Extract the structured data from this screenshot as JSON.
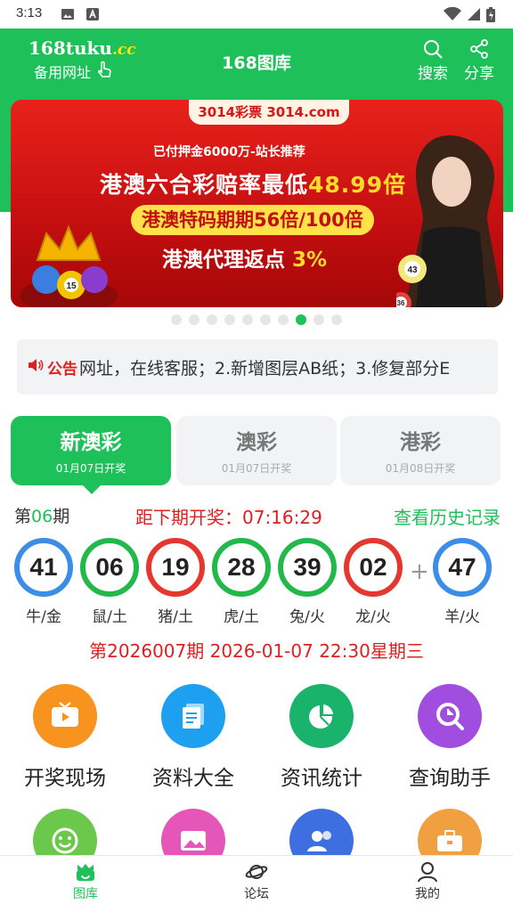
{
  "status_bar": {
    "time": "3:13"
  },
  "header": {
    "logo_main": "168tuku",
    "logo_suffix": ".cc",
    "backup_label": "备用网址",
    "title": "168图库",
    "search_label": "搜索",
    "share_label": "分享"
  },
  "banner": {
    "brand": "3014彩票 3014.com",
    "subline": "已付押金6000万-站长推荐",
    "line1": "港澳六合彩赔率最低",
    "line1_highlight": "48.99倍",
    "line2": "港澳特码期期56倍/100倍",
    "line3": "港澳代理返点",
    "line3_highlight": "3%",
    "ball_a": "15",
    "ball_b": "43",
    "ball_c": "36"
  },
  "carousel": {
    "count": 10,
    "active_index": 7
  },
  "notice": {
    "label": "公告",
    "text": "网址，在线客服；2.新增图层AB纸；3.修复部分E"
  },
  "tabs": [
    {
      "name": "新澳彩",
      "date": "01月07日开奖",
      "active": true
    },
    {
      "name": "澳彩",
      "date": "01月07日开奖",
      "active": false
    },
    {
      "name": "港彩",
      "date": "01月08日开奖",
      "active": false
    }
  ],
  "period": {
    "prefix": "第",
    "number": "06",
    "suffix": "期",
    "countdown": "距下期开奖：07:16:29",
    "history_link": "查看历史记录"
  },
  "balls": [
    {
      "num": "41",
      "zodiac": "牛/金",
      "color": "blue"
    },
    {
      "num": "06",
      "zodiac": "鼠/土",
      "color": "green"
    },
    {
      "num": "19",
      "zodiac": "猪/土",
      "color": "red"
    },
    {
      "num": "28",
      "zodiac": "虎/土",
      "color": "green"
    },
    {
      "num": "39",
      "zodiac": "兔/火",
      "color": "green"
    },
    {
      "num": "02",
      "zodiac": "龙/火",
      "color": "red"
    },
    {
      "num": "47",
      "zodiac": "羊/火",
      "color": "blue"
    }
  ],
  "plus_sign": "+",
  "next_draw": "第2026007期 2026-01-07 22:30星期三",
  "menu": [
    {
      "label": "开奖现场",
      "icon": "tv-icon",
      "color": "#f7931e"
    },
    {
      "label": "资料大全",
      "icon": "document-icon",
      "color": "#1ea0f0"
    },
    {
      "label": "资讯统计",
      "icon": "pie-chart-icon",
      "color": "#19b36b"
    },
    {
      "label": "查询助手",
      "icon": "search-chart-icon",
      "color": "#a14de0"
    }
  ],
  "menu_row2": [
    {
      "icon": "smile-icon",
      "color": "#6cc84a"
    },
    {
      "icon": "gallery-icon",
      "color": "#e655b8"
    },
    {
      "icon": "users-icon",
      "color": "#3d6fe0"
    },
    {
      "icon": "briefcase-icon",
      "color": "#f0a040"
    }
  ],
  "bottom_nav": [
    {
      "label": "图库",
      "icon": "gallery-home-icon",
      "active": true
    },
    {
      "label": "论坛",
      "icon": "planet-icon",
      "active": false
    },
    {
      "label": "我的",
      "icon": "user-icon",
      "active": false
    }
  ],
  "colors": {
    "primary": "#1ec05a",
    "alert": "#e02020"
  }
}
